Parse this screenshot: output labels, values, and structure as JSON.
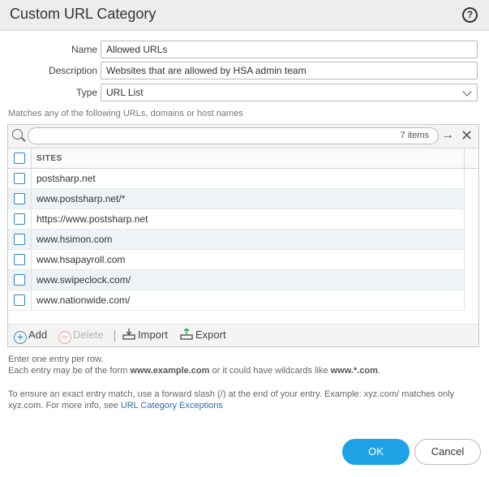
{
  "dialog": {
    "title": "Custom URL Category",
    "help": "?"
  },
  "form": {
    "name_label": "Name",
    "name_value": "Allowed URLs",
    "description_label": "Description",
    "description_value": "Websites that are allowed by HSA admin team",
    "type_label": "Type",
    "type_value": "URL List"
  },
  "hint_top": "Matches any of the following URLs, domains or host names",
  "grid": {
    "items_count": "7 items",
    "column_header": "SITES",
    "sites": [
      "postsharp.net",
      "www.postsharp.net/*",
      "https://www.postsharp.net",
      "www.hsimon.com",
      "www.hsapayroll.com",
      "www.swipeclock.com/",
      "www.nationwide.com/"
    ]
  },
  "toolbar": {
    "add": "Add",
    "delete": "Delete",
    "import": "Import",
    "export": "Export"
  },
  "info": {
    "line1": "Enter one entry per row.",
    "line2_pre": "Each entry may be of the form ",
    "line2_ex1": "www.example.com",
    "line2_mid": " or it could have wildcards like ",
    "line2_ex2": "www.*.com",
    "line2_post": ".",
    "line3": "To ensure an exact entry match, use a forward slash (/) at the end of your entry. Example: xyz.com/ matches only",
    "line4_pre": "xyz.com. For more info, see ",
    "line4_link": "URL Category Exceptions"
  },
  "buttons": {
    "ok": "OK",
    "cancel": "Cancel"
  },
  "colors": {
    "accent": "#1fa1e6",
    "checkbox_border": "#2a88c8",
    "link": "#2a6fb0"
  }
}
